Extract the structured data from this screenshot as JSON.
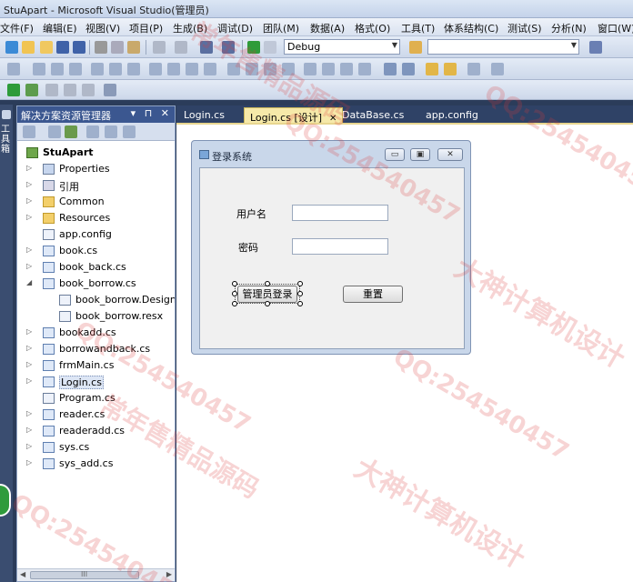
{
  "window": {
    "title": "StuApart - Microsoft Visual Studio(管理员)"
  },
  "menu": [
    "文件(F)",
    "编辑(E)",
    "视图(V)",
    "项目(P)",
    "生成(B)",
    "调试(D)",
    "团队(M)",
    "数据(A)",
    "格式(O)",
    "工具(T)",
    "体系结构(C)",
    "测试(S)",
    "分析(N)",
    "窗口(W)"
  ],
  "toolbar": {
    "config": "Debug",
    "search_value": ""
  },
  "side_tab": {
    "label": "工具箱"
  },
  "solution": {
    "title": "解决方案资源管理器",
    "controls": "▾ ⊓ ✕",
    "project": "StuApart",
    "items": [
      {
        "label": "Properties",
        "type": "props",
        "expander": "▷"
      },
      {
        "label": "引用",
        "type": "ref",
        "expander": "▷"
      },
      {
        "label": "Common",
        "type": "folder",
        "expander": "▷"
      },
      {
        "label": "Resources",
        "type": "folder",
        "expander": "▷"
      },
      {
        "label": "app.config",
        "type": "file",
        "expander": ""
      },
      {
        "label": "book.cs",
        "type": "cs",
        "expander": "▷"
      },
      {
        "label": "book_back.cs",
        "type": "cs",
        "expander": "▷"
      },
      {
        "label": "book_borrow.cs",
        "type": "cs",
        "expander": "◢"
      },
      {
        "label": "book_borrow.Designer.cs",
        "type": "file",
        "expander": ""
      },
      {
        "label": "book_borrow.resx",
        "type": "file",
        "expander": ""
      },
      {
        "label": "bookadd.cs",
        "type": "cs",
        "expander": "▷"
      },
      {
        "label": "borrowandback.cs",
        "type": "cs",
        "expander": "▷"
      },
      {
        "label": "frmMain.cs",
        "type": "cs",
        "expander": "▷"
      },
      {
        "label": "Login.cs",
        "type": "cs",
        "expander": "▷"
      },
      {
        "label": "Program.cs",
        "type": "file",
        "expander": ""
      },
      {
        "label": "reader.cs",
        "type": "cs",
        "expander": "▷"
      },
      {
        "label": "readeradd.cs",
        "type": "cs",
        "expander": "▷"
      },
      {
        "label": "sys.cs",
        "type": "cs",
        "expander": "▷"
      },
      {
        "label": "sys_add.cs",
        "type": "cs",
        "expander": "▷"
      }
    ],
    "hscroll": "III"
  },
  "tabs": [
    {
      "label": "Login.cs",
      "active": false
    },
    {
      "label": "Login.cs [设计]",
      "active": true,
      "close": "✕"
    },
    {
      "label": "DataBase.cs",
      "active": false
    },
    {
      "label": "app.config",
      "active": false
    }
  ],
  "form": {
    "title": "登录系统",
    "min": "▭",
    "max": "▣",
    "close": "✕",
    "username_label": "用户名",
    "password_label": "密码",
    "login_button": "管理员登录",
    "reset_button": "重置"
  },
  "watermarks": {
    "qq": "QQ:254540457",
    "shop": "常年售精品源码",
    "design": "大神计算机设计"
  },
  "colors": {
    "accent": "#3b5790",
    "active_tab": "#f6e9a9",
    "watermark": "#dc3c3c"
  }
}
